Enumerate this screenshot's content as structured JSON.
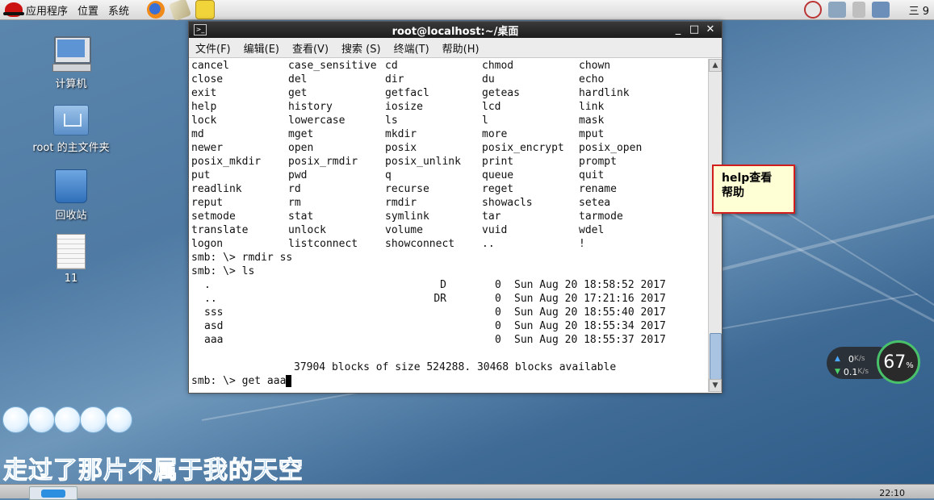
{
  "top_panel": {
    "menus": [
      "应用程序",
      "位置",
      "系统"
    ],
    "right_clock": "三 9"
  },
  "desktop": {
    "icons": [
      {
        "label": "计算机"
      },
      {
        "label": "root 的主文件夹"
      },
      {
        "label": "回收站"
      },
      {
        "label": "11"
      }
    ]
  },
  "terminal": {
    "title": "root@localhost:~/桌面",
    "menus": [
      "文件(F)",
      "编辑(E)",
      "查看(V)",
      "搜索 (S)",
      "终端(T)",
      "帮助(H)"
    ],
    "window_buttons": [
      "_",
      "□",
      "✕"
    ],
    "command_rows": [
      [
        "cancel",
        "case_sensitive",
        "cd",
        "chmod",
        "chown"
      ],
      [
        "close",
        "del",
        "dir",
        "du",
        "echo"
      ],
      [
        "exit",
        "get",
        "getfacl",
        "geteas",
        "hardlink"
      ],
      [
        "help",
        "history",
        "iosize",
        "lcd",
        "link"
      ],
      [
        "lock",
        "lowercase",
        "ls",
        "l",
        "mask"
      ],
      [
        "md",
        "mget",
        "mkdir",
        "more",
        "mput"
      ],
      [
        "newer",
        "open",
        "posix",
        "posix_encrypt",
        "posix_open"
      ],
      [
        "posix_mkdir",
        "posix_rmdir",
        "posix_unlink",
        "print",
        "prompt"
      ],
      [
        "put",
        "pwd",
        "q",
        "queue",
        "quit"
      ],
      [
        "readlink",
        "rd",
        "recurse",
        "reget",
        "rename"
      ],
      [
        "reput",
        "rm",
        "rmdir",
        "showacls",
        "setea"
      ],
      [
        "setmode",
        "stat",
        "symlink",
        "tar",
        "tarmode"
      ],
      [
        "translate",
        "unlock",
        "volume",
        "vuid",
        "wdel"
      ],
      [
        "logon",
        "listconnect",
        "showconnect",
        "..",
        "!"
      ]
    ],
    "prompt_lines": [
      "smb: \\> rmdir ss",
      "smb: \\> ls"
    ],
    "listing": [
      {
        "name": ".",
        "attr": "D",
        "size": "0",
        "date": "Sun Aug 20 18:58:52 2017"
      },
      {
        "name": "..",
        "attr": "DR",
        "size": "0",
        "date": "Sun Aug 20 17:21:16 2017"
      },
      {
        "name": "sss",
        "attr": "",
        "size": "0",
        "date": "Sun Aug 20 18:55:40 2017"
      },
      {
        "name": "asd",
        "attr": "",
        "size": "0",
        "date": "Sun Aug 20 18:55:34 2017"
      },
      {
        "name": "aaa",
        "attr": "",
        "size": "0",
        "date": "Sun Aug 20 18:55:37 2017"
      }
    ],
    "blocks_line": "37904 blocks of size 524288. 30468 blocks available",
    "current_prompt": "smb: \\> get aaa"
  },
  "note": {
    "text": "help查看帮助",
    "line1": "help查看",
    "line2": "帮助"
  },
  "net_widget": {
    "up": "0",
    "down": "0.1",
    "unit": "K/s",
    "percent": "67",
    "percent_unit": "%"
  },
  "lyric": "走过了那片不属于我的天空",
  "taskbar": {
    "clock": "22:10"
  }
}
